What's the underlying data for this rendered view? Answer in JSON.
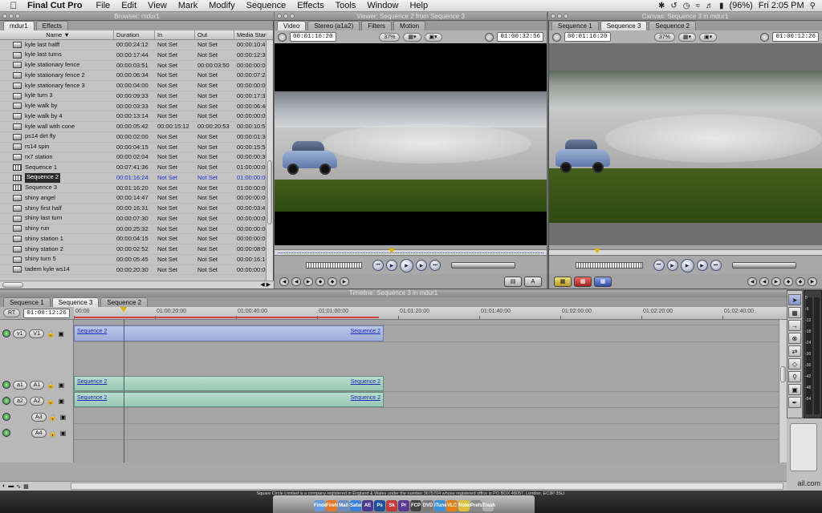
{
  "menubar": {
    "app": "Final Cut Pro",
    "items": [
      "File",
      "Edit",
      "View",
      "Mark",
      "Modify",
      "Sequence",
      "Effects",
      "Tools",
      "Window",
      "Help"
    ],
    "battery": "(96%)",
    "clock": "Fri 2:05 PM"
  },
  "browser": {
    "title": "Browser: mdur1",
    "tabs": [
      "mdur1",
      "Effects"
    ],
    "columns": [
      "Name",
      "Duration",
      "In",
      "Out",
      "Media Start"
    ],
    "rows": [
      {
        "name": "kyle last halff",
        "dur": "00:00:24:12",
        "in": "Not Set",
        "out": "Not Set",
        "ms": "00:00:10:4(",
        "type": "clip"
      },
      {
        "name": "kyle last turns",
        "dur": "00:00:17:44",
        "in": "Not Set",
        "out": "Not Set",
        "ms": "00:00:12:30",
        "type": "clip"
      },
      {
        "name": "kyle stationary fence",
        "dur": "00:00:03:51",
        "in": "Not Set",
        "out": "00:00:03:50",
        "ms": "00:00:00:00",
        "type": "clip"
      },
      {
        "name": "kyle stationary fence 2",
        "dur": "00:00:06:34",
        "in": "Not Set",
        "out": "Not Set",
        "ms": "00:00:07:28",
        "type": "clip"
      },
      {
        "name": "kyle stationary fence 3",
        "dur": "00:00:04:00",
        "in": "Not Set",
        "out": "Not Set",
        "ms": "00:00:00:00",
        "type": "clip"
      },
      {
        "name": "kyle turn 3",
        "dur": "00:00:09:33",
        "in": "Not Set",
        "out": "Not Set",
        "ms": "00:00:17:31",
        "type": "clip"
      },
      {
        "name": "kyle walk by",
        "dur": "00:00:03:33",
        "in": "Not Set",
        "out": "Not Set",
        "ms": "00:00:06:40",
        "type": "clip"
      },
      {
        "name": "kyle walk by 4",
        "dur": "00:00:13:14",
        "in": "Not Set",
        "out": "Not Set",
        "ms": "00:00:00:00",
        "type": "clip"
      },
      {
        "name": "kyle wall with cone",
        "dur": "00:00:05:42",
        "in": "00:00:15:12",
        "out": "00:00:20:53",
        "ms": "00:00:10:51",
        "type": "clip"
      },
      {
        "name": "ps14 dirt fly",
        "dur": "00:00:02:00",
        "in": "Not Set",
        "out": "Not Set",
        "ms": "00:00:01:30",
        "type": "clip"
      },
      {
        "name": "rs14 spin",
        "dur": "00:00:04:15",
        "in": "Not Set",
        "out": "Not Set",
        "ms": "00:00:15:54",
        "type": "clip"
      },
      {
        "name": "rx7 station",
        "dur": "00:00:02:04",
        "in": "Not Set",
        "out": "Not Set",
        "ms": "00:00:00:30",
        "type": "clip"
      },
      {
        "name": "Sequence 1",
        "dur": "00:07:41:36",
        "in": "Not Set",
        "out": "Not Set",
        "ms": "01:00:00:00",
        "type": "seq"
      },
      {
        "name": "Sequence 2",
        "dur": "00:01:16:24",
        "in": "Not Set",
        "out": "Not Set",
        "ms": "01:00:00:00",
        "type": "seq",
        "selected": true
      },
      {
        "name": "Sequence 3",
        "dur": "00:01:16:20",
        "in": "Not Set",
        "out": "Not Set",
        "ms": "01:00:00:00",
        "type": "seq"
      },
      {
        "name": "shiny angel",
        "dur": "00:00:14:47",
        "in": "Not Set",
        "out": "Not Set",
        "ms": "00:00:00:00",
        "type": "clip"
      },
      {
        "name": "shiny first half",
        "dur": "00:00:16:31",
        "in": "Not Set",
        "out": "Not Set",
        "ms": "00:00:03:49",
        "type": "clip"
      },
      {
        "name": "shiny last turn",
        "dur": "00:00:07:30",
        "in": "Not Set",
        "out": "Not Set",
        "ms": "00:00:00:00",
        "type": "clip"
      },
      {
        "name": "shiny run",
        "dur": "00:00:25:32",
        "in": "Not Set",
        "out": "Not Set",
        "ms": "00:00:00:00",
        "type": "clip"
      },
      {
        "name": "shiny station 1",
        "dur": "00:00:04:15",
        "in": "Not Set",
        "out": "Not Set",
        "ms": "00:00:00:00",
        "type": "clip"
      },
      {
        "name": "shiny station 2",
        "dur": "00:00:02:52",
        "in": "Not Set",
        "out": "Not Set",
        "ms": "00:00:08:00",
        "type": "clip"
      },
      {
        "name": "shiny turn 5",
        "dur": "00:00:05:45",
        "in": "Not Set",
        "out": "Not Set",
        "ms": "00:00:16:16",
        "type": "clip"
      },
      {
        "name": "tadem kyle ws14",
        "dur": "00:00:20:30",
        "in": "Not Set",
        "out": "Not Set",
        "ms": "00:00:00:00",
        "type": "clip"
      }
    ]
  },
  "viewer": {
    "title": "Viewer: Sequence 2 from Sequence 3",
    "tabs": [
      "Video",
      "Stereo (a1a2)",
      "Filters",
      "Motion"
    ],
    "tc_left": "00:01:16:20",
    "zoom": "37%",
    "tc_right": "01:00:32:56"
  },
  "canvas": {
    "title": "Canvas: Sequence 3 in mdur1",
    "tabs": [
      "Sequence 1",
      "Sequence 3",
      "Sequence 2"
    ],
    "tc_left": "00:01:16:20",
    "zoom": "37%",
    "tc_right": "01:00:12:26"
  },
  "timeline": {
    "title": "Timeline: Sequence 3 in mdur1",
    "tabs": [
      "Sequence 1",
      "Sequence 3",
      "Sequence 2"
    ],
    "rt": "RT",
    "current_tc": "01:00:12:26",
    "ruler": [
      "00:00",
      "01:00:20:00",
      "01:00:40:00",
      "01:01:00:00",
      "01:01:20:00",
      "01:01:40:00",
      "01:02:00:00",
      "01:02:20:00",
      "01:02:40:00"
    ],
    "tracks": {
      "v1": {
        "src": "v1",
        "dst": "V1"
      },
      "a1": {
        "src": "a1",
        "dst": "A1"
      },
      "a2": {
        "src": "a2",
        "dst": "A2"
      },
      "a3": {
        "dst": "A3"
      },
      "a4": {
        "dst": "A4"
      }
    },
    "clip_label": "Sequence 2"
  },
  "tools_meters": {
    "db_marks": [
      "0",
      "-6",
      "-12",
      "-18",
      "-24",
      "-30",
      "-36",
      "-42",
      "-48",
      "-54"
    ]
  },
  "status": {
    "mail_fragment": "ail.com",
    "desktop_text": "Square Circle Limited is a company registered in England & Wales under the number 3675704 whose registered office is PO BOX 48057, London, EC3P 3SU."
  },
  "dock": {
    "icons": [
      "Finder",
      "Firefox",
      "Mail",
      "Safari",
      "AE",
      "Ps",
      "Sk",
      "Pr",
      "FCP",
      "DVD",
      "iTunes",
      "VLC",
      "Notes",
      "Prefs",
      "Trash"
    ]
  },
  "colors": {
    "selection_blue": "#1b2fd3",
    "video_clip": "#a9b7e2",
    "audio_clip": "#a6d2c0",
    "playhead_red": "#d54040"
  }
}
